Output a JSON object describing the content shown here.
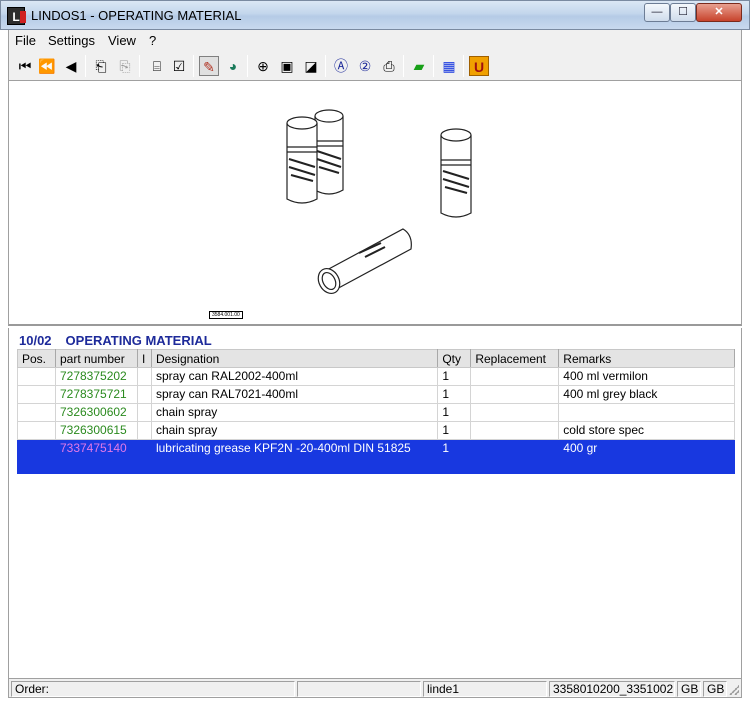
{
  "window": {
    "title": "LINDOS1 - OPERATING MATERIAL",
    "icon_letter": "L",
    "min_glyph": "—",
    "max_glyph": "☐",
    "close_glyph": "✕"
  },
  "menu": [
    "File",
    "Settings",
    "View",
    "?"
  ],
  "toolbar_icons": [
    "first-icon",
    "prev-page-icon",
    "prev-icon",
    "back-icon",
    "forward-icon",
    "cart-icon",
    "checklist-icon",
    "mark-icon",
    "globe-icon",
    "zoom-icon",
    "page-icon",
    "page-edit-icon",
    "a-circle-icon",
    "2-circle-icon",
    "print-icon",
    "green-book-icon",
    "blue-grid-icon",
    "u-icon"
  ],
  "section": {
    "number": "10/02",
    "title": "OPERATING MATERIAL"
  },
  "table": {
    "headers": [
      "Pos.",
      "part number",
      "I",
      "Designation",
      "Qty",
      "Replacement",
      "Remarks"
    ],
    "rows": [
      {
        "pos": "",
        "part": "7278375202",
        "i": "",
        "designation": "spray can RAL2002-400ml",
        "qty": "1",
        "replacement": "",
        "remarks": "400 ml vermilon"
      },
      {
        "pos": "",
        "part": "7278375721",
        "i": "",
        "designation": "spray can RAL7021-400ml",
        "qty": "1",
        "replacement": "",
        "remarks": "400 ml grey black"
      },
      {
        "pos": "",
        "part": "7326300602",
        "i": "",
        "designation": "chain spray",
        "qty": "1",
        "replacement": "",
        "remarks": ""
      },
      {
        "pos": "",
        "part": "7326300615",
        "i": "",
        "designation": "chain spray",
        "qty": "1",
        "replacement": "",
        "remarks": "cold store spec"
      },
      {
        "pos": "",
        "part": "7337475140",
        "i": "",
        "designation": "lubricating grease KPF2N -20-400ml  DIN 51825",
        "qty": "1",
        "replacement": "",
        "remarks": "400 gr"
      }
    ],
    "selected_row": 4
  },
  "drawing": {
    "ref_label": "3584.001.00"
  },
  "status": {
    "order_label": "Order:",
    "user": "linde1",
    "doc": "3358010200_3351002",
    "lang1": "GB",
    "lang2": "GB"
  },
  "colors": {
    "selection": "#1838e0",
    "part_number": "#2a8a1e",
    "section_title": "#1d2a9a"
  }
}
